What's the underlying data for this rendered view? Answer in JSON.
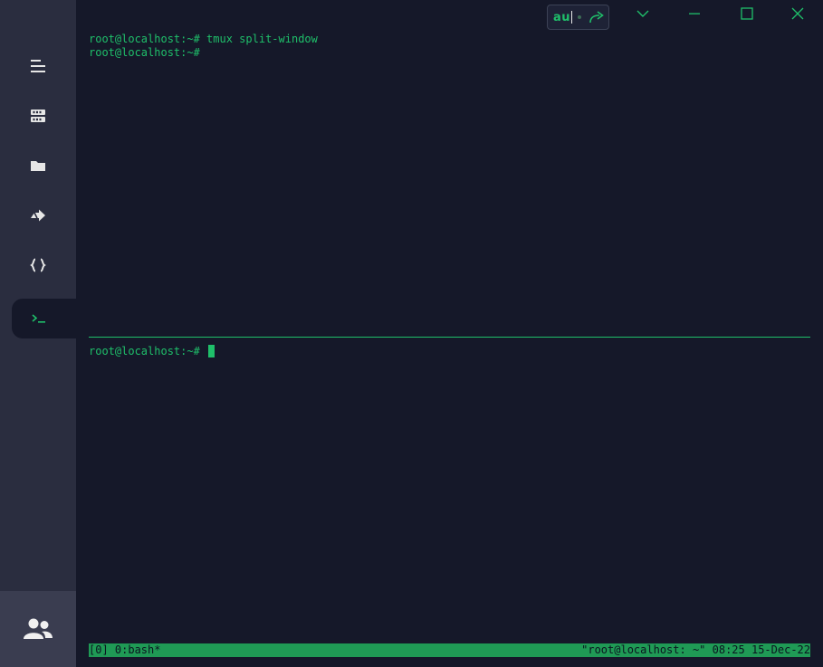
{
  "sidebar": {
    "items": [
      {
        "icon": "menu-icon"
      },
      {
        "icon": "server-icon"
      },
      {
        "icon": "folder-icon"
      },
      {
        "icon": "port-forward-icon"
      },
      {
        "icon": "code-braces-icon"
      },
      {
        "icon": "terminal-icon",
        "active": true
      }
    ],
    "bottom_icon": "users-icon"
  },
  "titlebar": {
    "search_value": "au",
    "share_icon": "share-icon",
    "dropdown_icon": "chevron-down-icon",
    "minimize_icon": "minimize-icon",
    "maximize_icon": "maximize-icon",
    "close_icon": "close-icon"
  },
  "terminal": {
    "top_pane": {
      "lines": [
        "root@localhost:~# tmux split-window",
        "root@localhost:~#"
      ]
    },
    "bottom_pane": {
      "prompt": "root@localhost:~# "
    },
    "status_bar": {
      "left": "[0] 0:bash*",
      "right": "\"root@localhost: ~\" 08:25 15-Dec-22"
    }
  },
  "colors": {
    "accent": "#1fbf6a",
    "background": "#151829",
    "sidebar": "#2a2d3f",
    "status_bar": "#1f9a55"
  }
}
